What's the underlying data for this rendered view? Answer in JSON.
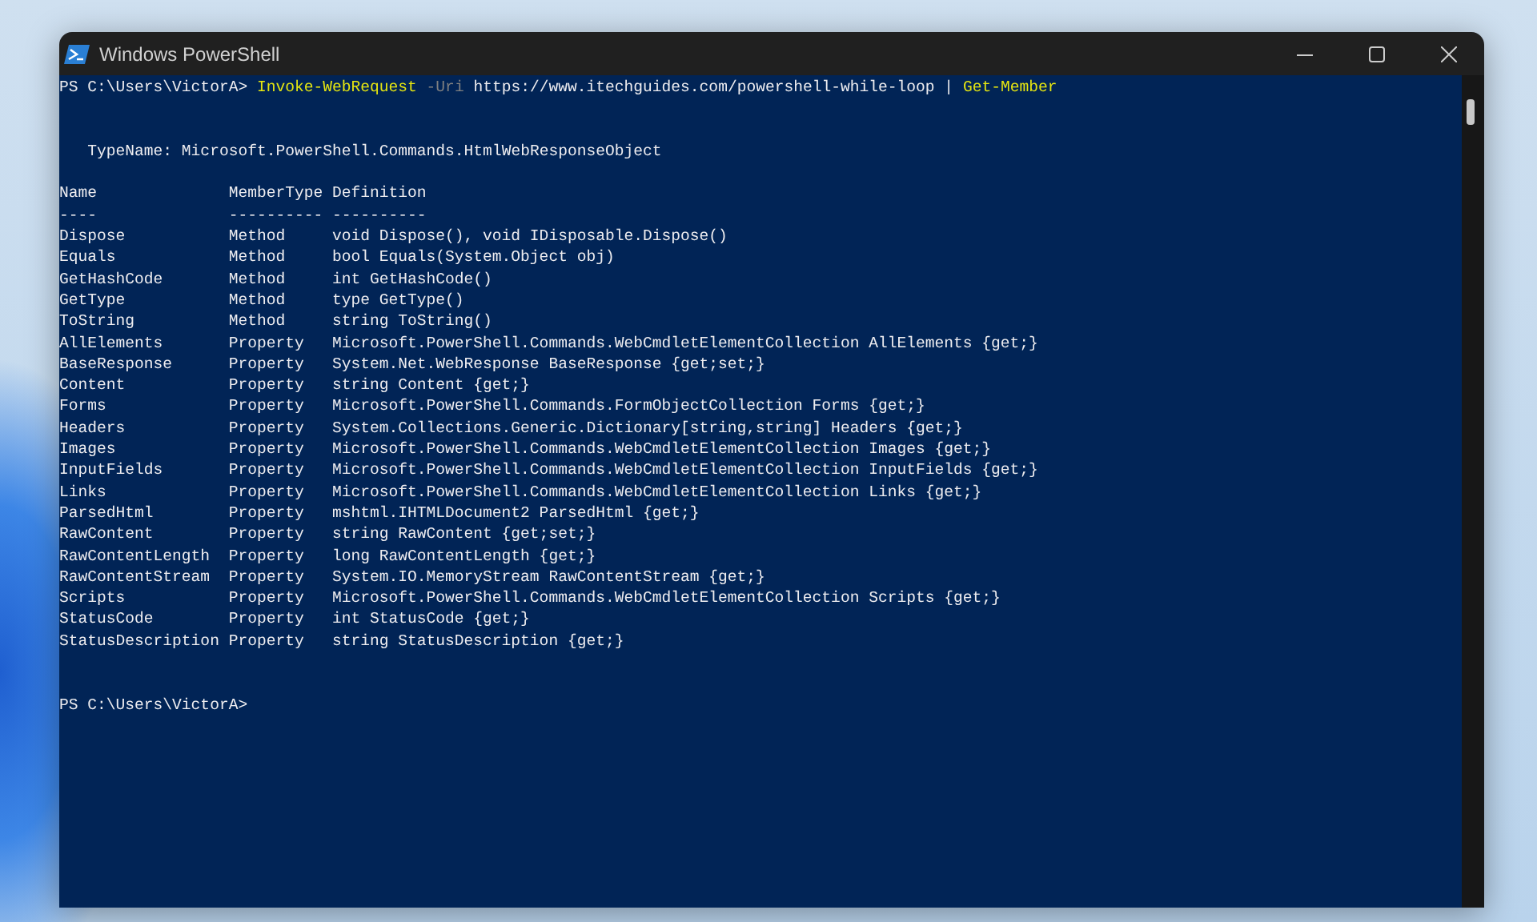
{
  "window": {
    "title": "Windows PowerShell"
  },
  "command": [
    {
      "kind": "prompt",
      "text": "PS C:\\Users\\VictorA> "
    },
    {
      "kind": "cmdlet",
      "text": "Invoke-WebRequest"
    },
    {
      "kind": "parameter",
      "text": " -Uri"
    },
    {
      "kind": "argument",
      "text": " https://www.itechguides.com/powershell-while-loop "
    },
    {
      "kind": "operator",
      "text": "|"
    },
    {
      "kind": "cmdlet",
      "text": " Get-Member"
    }
  ],
  "type_name": "   TypeName: Microsoft.PowerShell.Commands.HtmlWebResponseObject",
  "table": {
    "columns": [
      "Name",
      "MemberType",
      "Definition"
    ],
    "underlines": [
      "----",
      "----------",
      "----------"
    ],
    "rows": [
      [
        "Dispose",
        "Method",
        "void Dispose(), void IDisposable.Dispose()"
      ],
      [
        "Equals",
        "Method",
        "bool Equals(System.Object obj)"
      ],
      [
        "GetHashCode",
        "Method",
        "int GetHashCode()"
      ],
      [
        "GetType",
        "Method",
        "type GetType()"
      ],
      [
        "ToString",
        "Method",
        "string ToString()"
      ],
      [
        "AllElements",
        "Property",
        "Microsoft.PowerShell.Commands.WebCmdletElementCollection AllElements {get;}"
      ],
      [
        "BaseResponse",
        "Property",
        "System.Net.WebResponse BaseResponse {get;set;}"
      ],
      [
        "Content",
        "Property",
        "string Content {get;}"
      ],
      [
        "Forms",
        "Property",
        "Microsoft.PowerShell.Commands.FormObjectCollection Forms {get;}"
      ],
      [
        "Headers",
        "Property",
        "System.Collections.Generic.Dictionary[string,string] Headers {get;}"
      ],
      [
        "Images",
        "Property",
        "Microsoft.PowerShell.Commands.WebCmdletElementCollection Images {get;}"
      ],
      [
        "InputFields",
        "Property",
        "Microsoft.PowerShell.Commands.WebCmdletElementCollection InputFields {get;}"
      ],
      [
        "Links",
        "Property",
        "Microsoft.PowerShell.Commands.WebCmdletElementCollection Links {get;}"
      ],
      [
        "ParsedHtml",
        "Property",
        "mshtml.IHTMLDocument2 ParsedHtml {get;}"
      ],
      [
        "RawContent",
        "Property",
        "string RawContent {get;set;}"
      ],
      [
        "RawContentLength",
        "Property",
        "long RawContentLength {get;}"
      ],
      [
        "RawContentStream",
        "Property",
        "System.IO.MemoryStream RawContentStream {get;}"
      ],
      [
        "Scripts",
        "Property",
        "Microsoft.PowerShell.Commands.WebCmdletElementCollection Scripts {get;}"
      ],
      [
        "StatusCode",
        "Property",
        "int StatusCode {get;}"
      ],
      [
        "StatusDescription",
        "Property",
        "string StatusDescription {get;}"
      ]
    ]
  },
  "final_prompt": "PS C:\\Users\\VictorA>"
}
